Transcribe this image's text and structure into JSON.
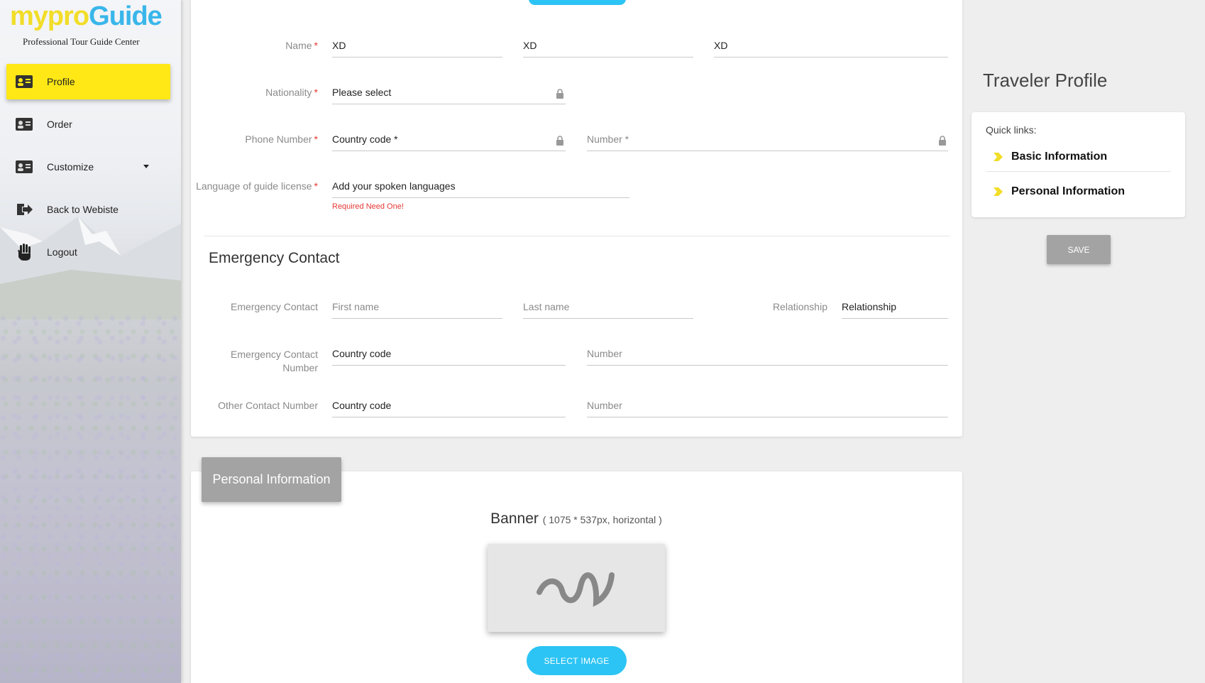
{
  "brand": {
    "logo_part1": "mypro",
    "logo_part2": "Guide",
    "tagline": "Professional Tour Guide Center",
    "colors": {
      "yellow": "#f2dd28",
      "blue": "#39b6ea"
    }
  },
  "sidebar": {
    "items": [
      {
        "label": "Profile",
        "icon": "id-card-icon",
        "active": true
      },
      {
        "label": "Order",
        "icon": "id-card-icon"
      },
      {
        "label": "Customize",
        "icon": "id-card-icon",
        "has_dropdown": true
      },
      {
        "label": "Back to Webiste",
        "icon": "exit-icon"
      },
      {
        "label": "Logout",
        "icon": "hand-icon"
      }
    ]
  },
  "form": {
    "name": {
      "label": "Name",
      "values": [
        "XD",
        "XD",
        "XD"
      ]
    },
    "nationality": {
      "label": "Nationality",
      "value": "Please select"
    },
    "phone": {
      "label": "Phone Number",
      "country_placeholder": "Country code *",
      "number_placeholder": "Number *"
    },
    "language": {
      "label": "Language of guide license",
      "value": "Add your spoken languages",
      "error": "Required Need One!"
    },
    "required_mark": "*"
  },
  "emergency": {
    "title": "Emergency Contact",
    "contact": {
      "label": "Emergency Contact",
      "first_placeholder": "First name",
      "last_placeholder": "Last name",
      "rel_label": "Relationship",
      "rel_value": "Relationship"
    },
    "contact_number": {
      "label_line1": "Emergency Contact",
      "label_line2": "Number",
      "country": "Country code",
      "number_placeholder": "Number"
    },
    "other_number": {
      "label": "Other Contact Number",
      "country": "Country code",
      "number_placeholder": "Number"
    }
  },
  "personal": {
    "tab_label": "Personal Information",
    "banner_title": "Banner",
    "banner_hint": "( 1075 * 537px, horizontal )",
    "select_button": "SELECT IMAGE"
  },
  "right": {
    "title": "Traveler Profile",
    "quick_links_heading": "Quick links:",
    "links": [
      "Basic Information",
      "Personal Information"
    ],
    "save_button": "SAVE"
  },
  "accent_color": "#2cc4f4",
  "active_nav_color": "#ffe815",
  "error_color": "#e53935"
}
